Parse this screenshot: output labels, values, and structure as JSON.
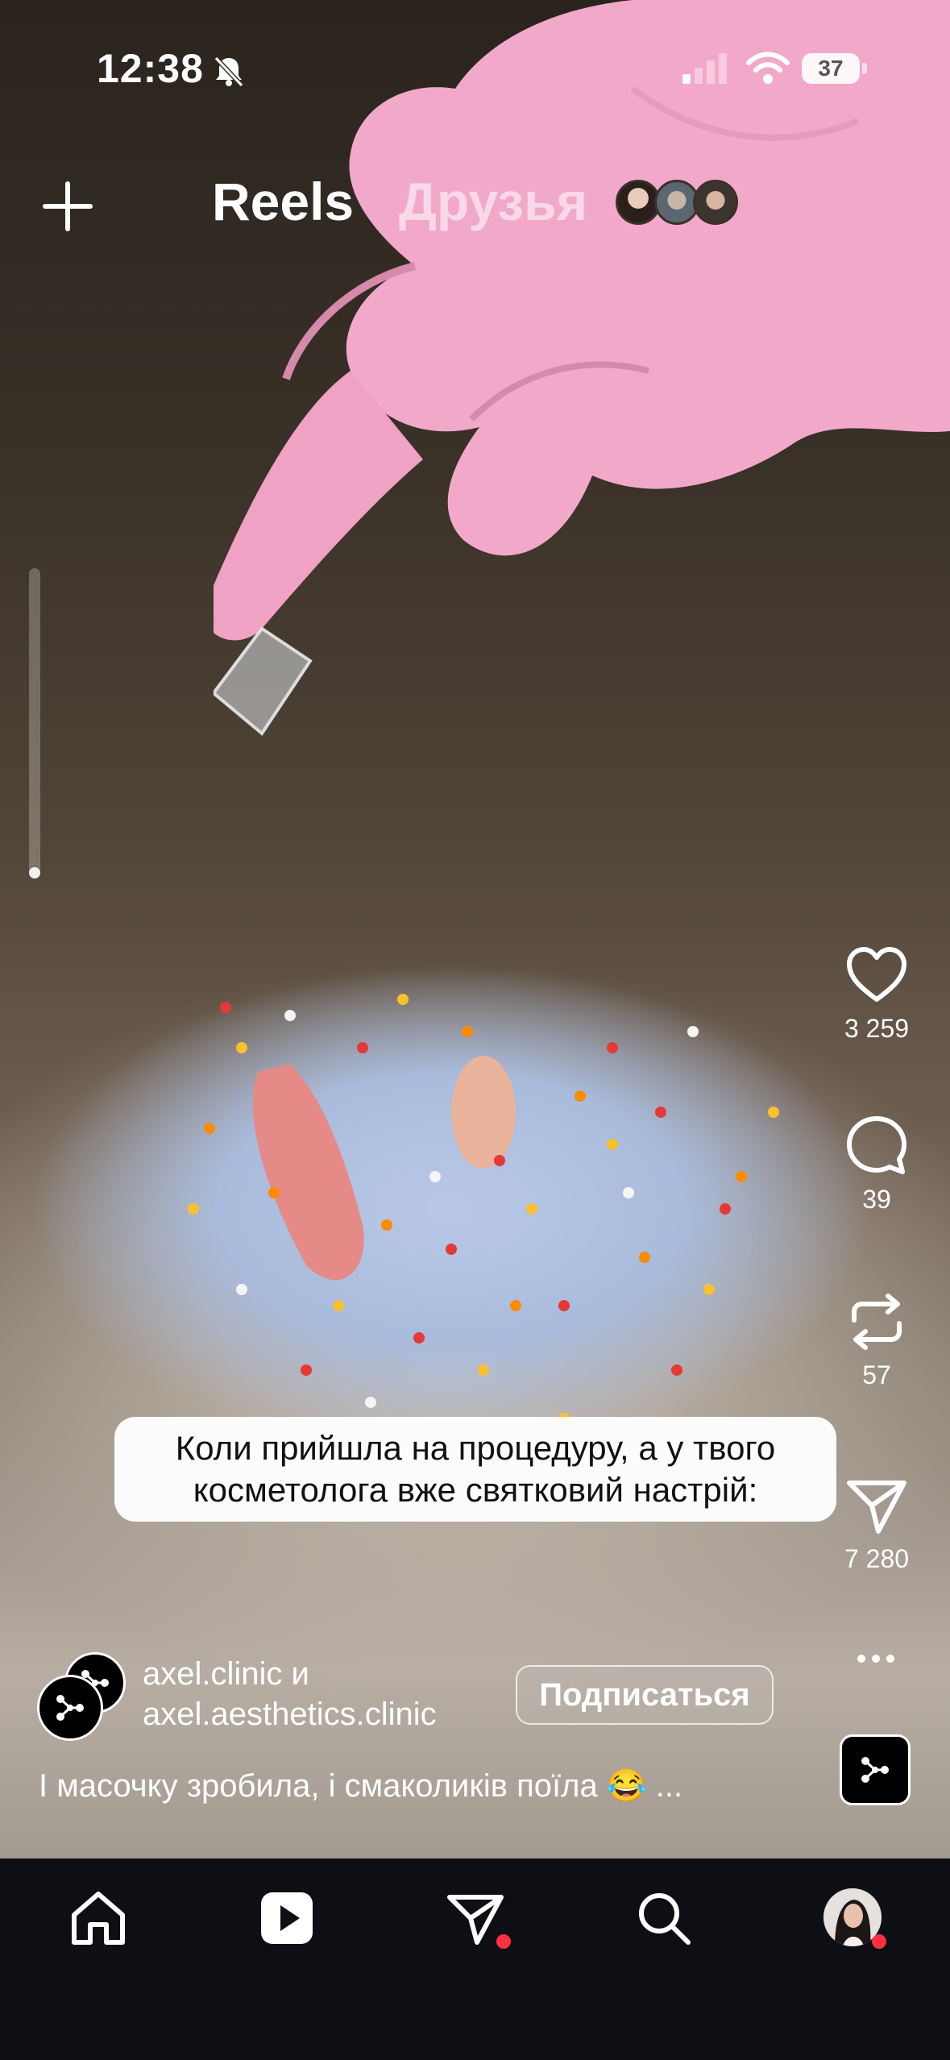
{
  "status_bar": {
    "time": "12:38",
    "battery": "37"
  },
  "top_bar": {
    "tab_reels": "Reels",
    "tab_friends": "Друзья"
  },
  "video": {
    "progress_fraction": 0.02
  },
  "actions": {
    "likes": "3 259",
    "comments": "39",
    "reposts": "57",
    "shares": "7 280"
  },
  "caption_overlay": {
    "line1": "Коли прийшла на процедуру, а у твого",
    "line2": "косметолога вже святковий настрій:"
  },
  "post": {
    "author1": "axel.clinic",
    "conjunction": "и",
    "author2": "axel.aesthetics.clinic",
    "follow_label": "Подписаться",
    "description": "І масочку зробила, і смаколиків поїла 😂 ..."
  },
  "colors": {
    "accent_red": "#ff3040",
    "nav_bg": "#0d0f14",
    "glove_pink": "#f2a9c9",
    "mask_blue": "#b9c8e6"
  }
}
